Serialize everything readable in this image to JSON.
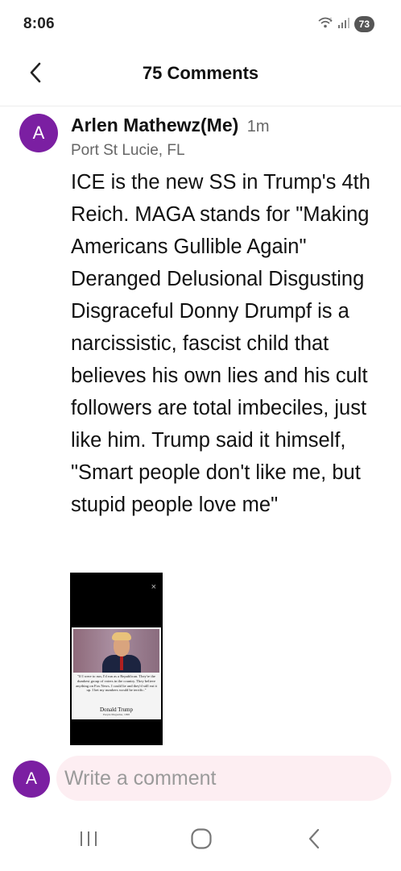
{
  "status_bar": {
    "time": "8:06",
    "battery_level": "73",
    "icons": [
      "wifi-icon",
      "signal-icon",
      "battery-icon"
    ]
  },
  "header": {
    "title": "75 Comments",
    "back_icon": "chevron-left-icon"
  },
  "comment": {
    "avatar_initial": "A",
    "avatar_color": "#7b1fa2",
    "author": "Arlen Mathewz(Me)",
    "time": "1m",
    "location": "Port St Lucie, FL",
    "body": "ICE is the new SS in Trump's 4th Reich. MAGA stands for \"Making Americans Gullible Again\" Deranged Delusional Disgusting Disgraceful Donny Drumpf is a narcissistic, fascist child that believes his own lies and his cult followers are total imbeciles, just like him. Trump said it himself, \"Smart people don't like me, but stupid people love me\"",
    "media": {
      "close_glyph": "×",
      "quote": "\"If I were to run, I'd run as a Republican. They're the dumbest group of voters in the country. They believe anything on Fox News. I could lie and they'd still eat it up. I bet my numbers would be terrific.\"",
      "attribution": "Donald Trump",
      "attribution_sub": "People Magazine, 1998"
    }
  },
  "composer": {
    "avatar_initial": "A",
    "placeholder": "Write a comment",
    "field_color": "#fdeef2"
  },
  "nav_bar": {
    "items": [
      "recent-apps-icon",
      "home-icon",
      "back-icon"
    ]
  }
}
